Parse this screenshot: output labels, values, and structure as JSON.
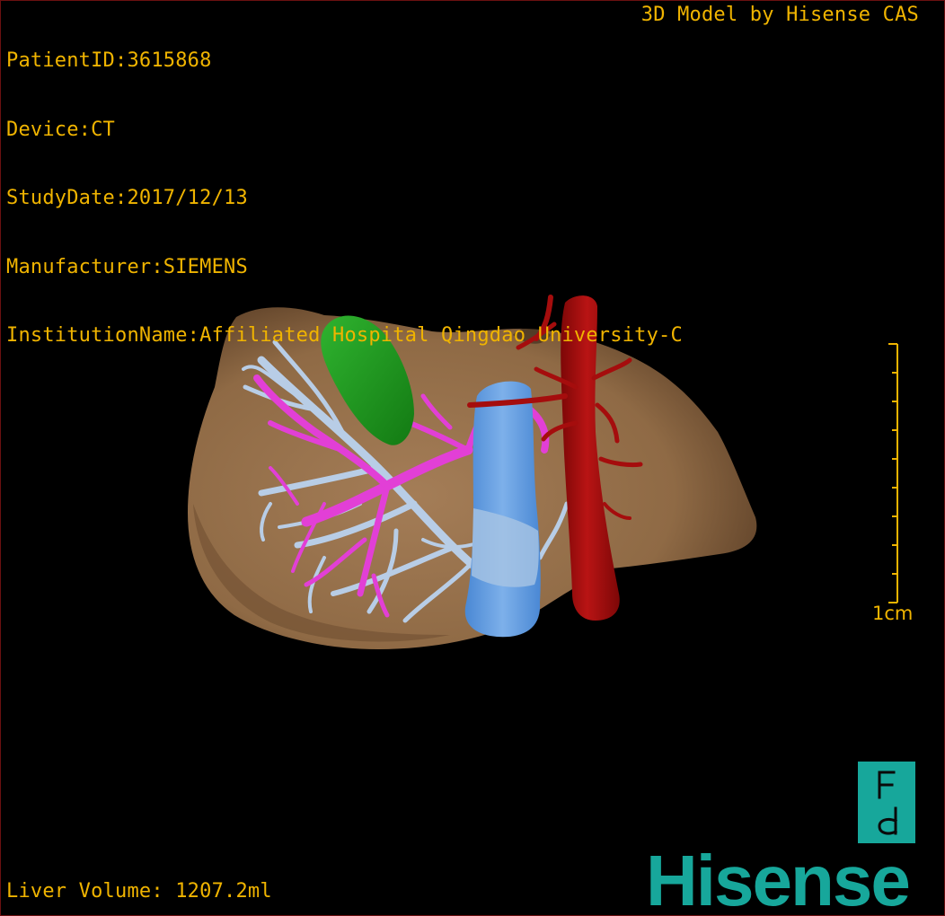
{
  "patient": {
    "id_line": "PatientID:3615868",
    "device_line": "Device:CT",
    "study_date_line": "StudyDate:2017/12/13",
    "manufacturer_line": "Manufacturer:SIEMENS",
    "institution_line": "InstitutionName:Affiliated Hospital Qingdao University-C"
  },
  "header": {
    "model_credit": "3D Model by Hisense CAS"
  },
  "scale_bar": {
    "label": "1cm"
  },
  "footer": {
    "liver_volume": "Liver Volume: 1207.2ml"
  },
  "branding": {
    "company_logo_text": "Hisense",
    "fd_logo_name": "fd-logo-icon"
  },
  "colors": {
    "overlay_text": "#f0b400",
    "liver": "#9c7550",
    "gallbladder": "#1f9a1f",
    "portal_vein": "#e23fd6",
    "hepatic_vein": "#b8cde6",
    "ivc": "#5b9ae0",
    "aorta": "#a50d0d",
    "brand": "#17a79b"
  },
  "structures": [
    "liver",
    "gallbladder",
    "portal-vein",
    "hepatic-veins",
    "inferior-vena-cava",
    "aorta"
  ]
}
